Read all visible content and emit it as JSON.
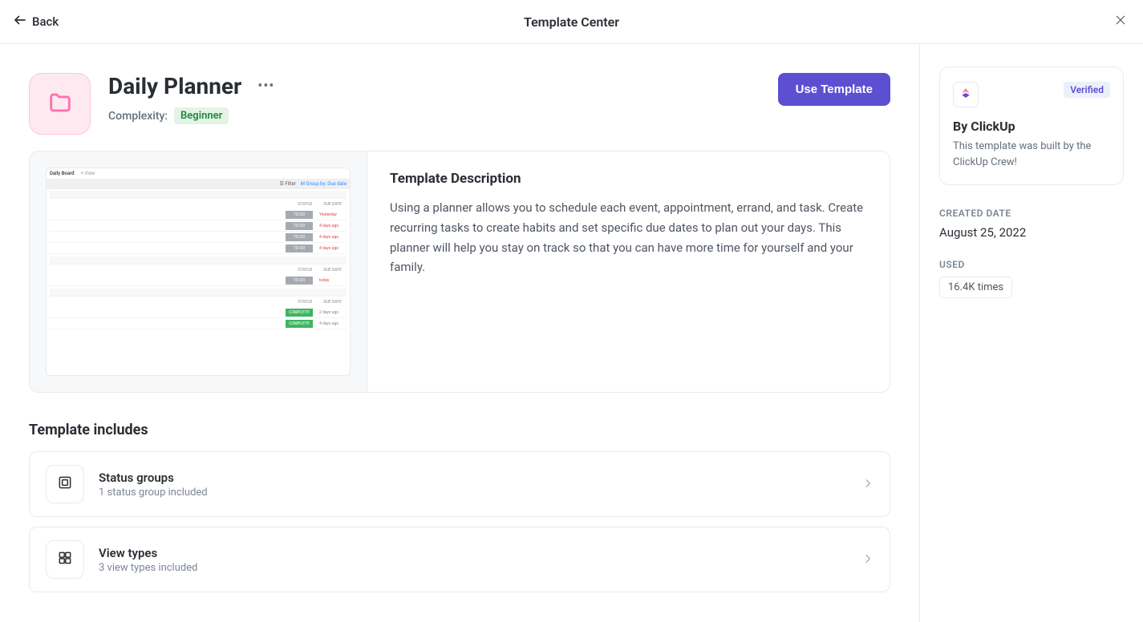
{
  "header": {
    "back_label": "Back",
    "title": "Template Center"
  },
  "template": {
    "title": "Daily Planner",
    "complexity_label": "Complexity:",
    "complexity_value": "Beginner",
    "use_button_label": "Use Template",
    "description_heading": "Template Description",
    "description_text": "Using a planner allows you to schedule each event, appointment, errand, and task. Create recurring tasks to create habits and set specific due dates to plan out your days. This planner will help you stay on track so that you can have more time for yourself and your family."
  },
  "preview": {
    "tab": "Daily Board",
    "add_view": "+ View",
    "filter": "☰ Filter",
    "group_by": "M Group by: Due date",
    "col_status": "STATUS",
    "col_duedate": "DUE DATE",
    "status_todo": "TO DO",
    "status_complete": "COMPLETE",
    "date_yesterday": "Yesterday",
    "date_4days": "4 days ago",
    "date_today": "today",
    "date_2days": "2 days ago"
  },
  "includes": {
    "heading": "Template includes",
    "items": [
      {
        "title": "Status groups",
        "subtitle": "1 status group included"
      },
      {
        "title": "View types",
        "subtitle": "3 view types included"
      }
    ]
  },
  "author": {
    "verified_label": "Verified",
    "name": "By ClickUp",
    "description": "This template was built by the ClickUp Crew!"
  },
  "meta": {
    "created_label": "CREATED DATE",
    "created_value": "August 25, 2022",
    "used_label": "USED",
    "used_value": "16.4K times"
  }
}
